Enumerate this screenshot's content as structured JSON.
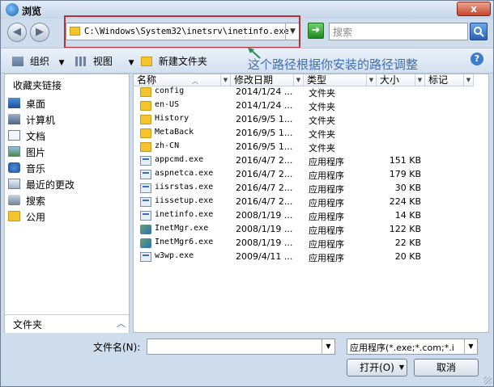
{
  "window": {
    "title": "浏览",
    "close_label": "x"
  },
  "address_bar": {
    "path": "C:\\Windows\\System32\\inetsrv\\inetinfo.exe"
  },
  "search": {
    "placeholder": "搜索"
  },
  "toolbar": {
    "organize_label": "组织",
    "view_label": "视图",
    "new_folder_label": "新建文件夹"
  },
  "annotation": {
    "text": "这个路径根据你安装的路径调整"
  },
  "sidebar": {
    "header": "收藏夹链接",
    "items": [
      {
        "label": "桌面",
        "icon": "desktop-icon"
      },
      {
        "label": "计算机",
        "icon": "computer-icon"
      },
      {
        "label": "文档",
        "icon": "documents-icon"
      },
      {
        "label": "图片",
        "icon": "pictures-icon"
      },
      {
        "label": "音乐",
        "icon": "music-icon"
      },
      {
        "label": "最近的更改",
        "icon": "recent-changes-icon"
      },
      {
        "label": "搜索",
        "icon": "search-icon"
      },
      {
        "label": "公用",
        "icon": "public-folder-icon"
      }
    ],
    "folders_label": "文件夹"
  },
  "file_list": {
    "columns": {
      "name": "名称",
      "date": "修改日期",
      "type": "类型",
      "size": "大小",
      "tags": "标记"
    },
    "rows": [
      {
        "name": "config",
        "date": "2014/1/24 ...",
        "type": "文件夹",
        "size": "",
        "kind": "folder"
      },
      {
        "name": "en-US",
        "date": "2014/1/24 ...",
        "type": "文件夹",
        "size": "",
        "kind": "folder"
      },
      {
        "name": "History",
        "date": "2016/9/5 1...",
        "type": "文件夹",
        "size": "",
        "kind": "folder"
      },
      {
        "name": "MetaBack",
        "date": "2016/9/5 1...",
        "type": "文件夹",
        "size": "",
        "kind": "folder"
      },
      {
        "name": "zh-CN",
        "date": "2016/9/5 1...",
        "type": "文件夹",
        "size": "",
        "kind": "folder"
      },
      {
        "name": "appcmd.exe",
        "date": "2016/4/7 2...",
        "type": "应用程序",
        "size": "151 KB",
        "kind": "exe"
      },
      {
        "name": "aspnetca.exe",
        "date": "2016/4/7 2...",
        "type": "应用程序",
        "size": "179 KB",
        "kind": "exe"
      },
      {
        "name": "iisrstas.exe",
        "date": "2016/4/7 2...",
        "type": "应用程序",
        "size": "30 KB",
        "kind": "exe"
      },
      {
        "name": "iissetup.exe",
        "date": "2016/4/7 2...",
        "type": "应用程序",
        "size": "224 KB",
        "kind": "exe"
      },
      {
        "name": "inetinfo.exe",
        "date": "2008/1/19 ...",
        "type": "应用程序",
        "size": "14 KB",
        "kind": "exe"
      },
      {
        "name": "InetMgr.exe",
        "date": "2008/1/19 ...",
        "type": "应用程序",
        "size": "122 KB",
        "kind": "mgr"
      },
      {
        "name": "InetMgr6.exe",
        "date": "2008/1/19 ...",
        "type": "应用程序",
        "size": "22 KB",
        "kind": "mgr"
      },
      {
        "name": "w3wp.exe",
        "date": "2009/4/11 ...",
        "type": "应用程序",
        "size": "20 KB",
        "kind": "exe"
      }
    ]
  },
  "bottom": {
    "filename_label": "文件名(N):",
    "filename_value": "",
    "filetype_value": "应用程序(*.exe;*.com;*.i",
    "open_label": "打开(O)",
    "cancel_label": "取消"
  }
}
